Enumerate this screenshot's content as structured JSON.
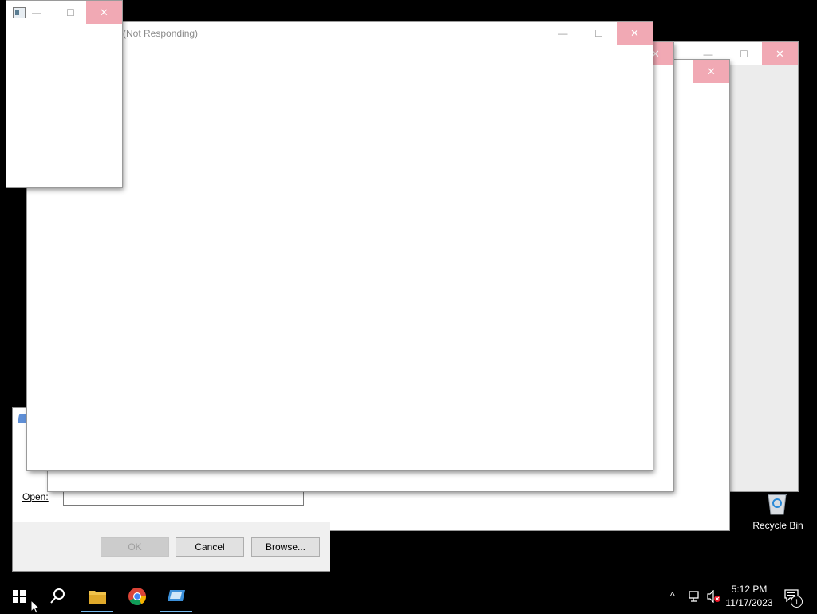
{
  "windows": {
    "front": {
      "title": "(Not Responding)",
      "minimize": "—",
      "maximize": "☐",
      "close": "✕"
    },
    "back_small": {
      "minimize": "—",
      "maximize": "☐",
      "close": "✕"
    },
    "right": {
      "minimize": "—",
      "maximize": "☐",
      "close": "✕"
    },
    "mid": {
      "close": "✕"
    },
    "mid2": {
      "close": "✕"
    }
  },
  "run_dialog": {
    "open_label": "Open:",
    "ok_label": "OK",
    "cancel_label": "Cancel",
    "browse_label": "Browse..."
  },
  "desktop": {
    "recycle_bin_label": "Recycle Bin"
  },
  "taskbar": {
    "apps": [
      "start",
      "search",
      "file-explorer",
      "chrome",
      "remote-desktop"
    ],
    "clock_time": "5:12 PM",
    "clock_date": "11/17/2023",
    "notification_count": "1"
  },
  "colors": {
    "close_pink": "#f1a9b4",
    "taskbar": "#000000",
    "active_underline": "#76b9ed"
  }
}
